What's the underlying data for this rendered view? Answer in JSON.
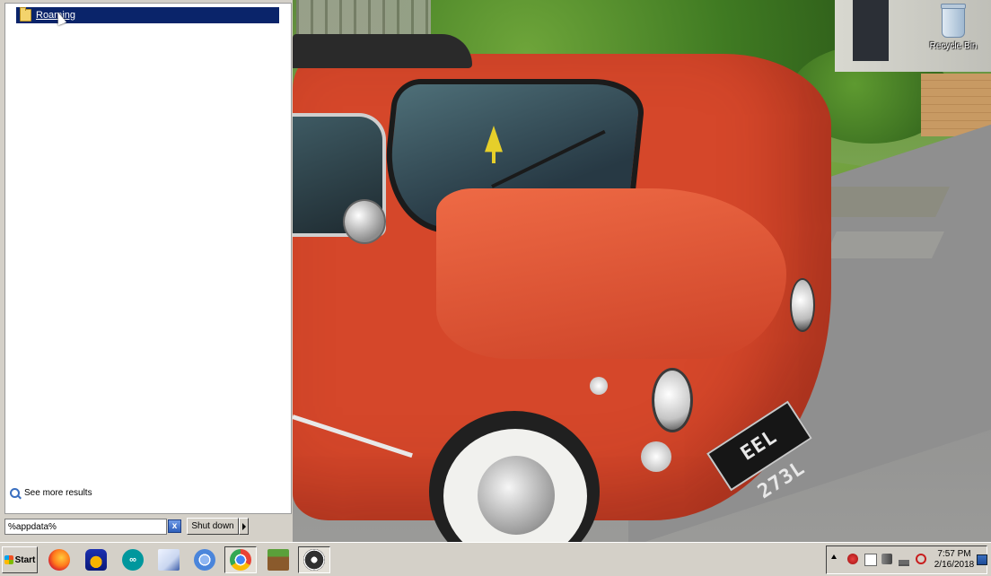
{
  "desktop": {
    "recycle_bin_label": "Recycle Bin",
    "plate_text": "EEL 273L"
  },
  "start_menu": {
    "results": [
      {
        "label": "Roaming",
        "icon": "folder-icon",
        "selected": true
      }
    ],
    "see_more_label": "See more results",
    "search_value": "%appdata%",
    "clear_icon": "x",
    "shutdown_label": "Shut down"
  },
  "taskbar": {
    "start_label": "Start",
    "pinned": [
      {
        "name": "firefox",
        "icon": "firefox-icon"
      },
      {
        "name": "audacity",
        "icon": "audacity-icon"
      },
      {
        "name": "arduino",
        "icon": "arduino-icon"
      },
      {
        "name": "editor",
        "icon": "editor-icon"
      },
      {
        "name": "chromium",
        "icon": "chromium-icon"
      },
      {
        "name": "chrome",
        "icon": "chrome-icon"
      },
      {
        "name": "minecraft",
        "icon": "minecraft-icon"
      },
      {
        "name": "obs",
        "icon": "obs-icon"
      }
    ],
    "clock_time": "7:57 PM",
    "clock_date": "2/16/2018"
  },
  "colors": {
    "selection": "#0a246a",
    "face": "#d4d0c8"
  }
}
